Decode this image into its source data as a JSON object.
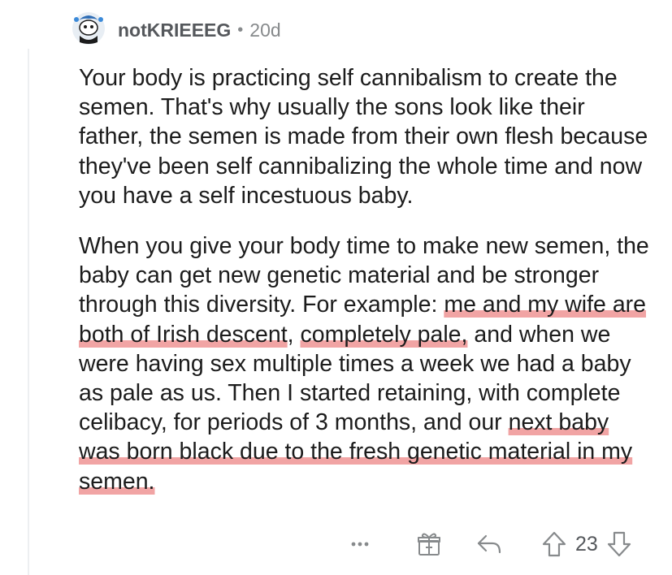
{
  "comment": {
    "author": "notKRIEEEG",
    "separator": "•",
    "age": "20d",
    "paragraph1": "Your body is practicing self cannibalism to create the semen. That's why usually the sons look like their father, the semen is made from their own flesh because they've been self cannibalizing the whole time and now you have a self incestuous baby.",
    "p2_part1": "When you give your body time to make new semen, the baby can get new genetic material and be stronger through this diversity. For example: ",
    "p2_hl1": "me and my wife are both of Irish descent",
    "p2_part2": ", ",
    "p2_hl2": "completely pale,",
    "p2_part3": " and when we were having sex multiple times a week we had a baby as pale as us. Then I started retaining, with complete celibacy, for periods of 3 months, and our ",
    "p2_hl3": "next baby was born black due to the fresh genetic material in my semen.",
    "vote_count": "23"
  },
  "icons": {
    "avatar": "snoo-avatar-icon",
    "more": "more-options-icon",
    "award": "award-icon",
    "reply": "reply-arrow-icon",
    "upvote": "upvote-arrow-icon",
    "downvote": "downvote-arrow-icon"
  },
  "colors": {
    "highlight": "#e65a5a",
    "username": "#55585c",
    "meta": "#878a8c",
    "text": "#1c1c1c"
  }
}
